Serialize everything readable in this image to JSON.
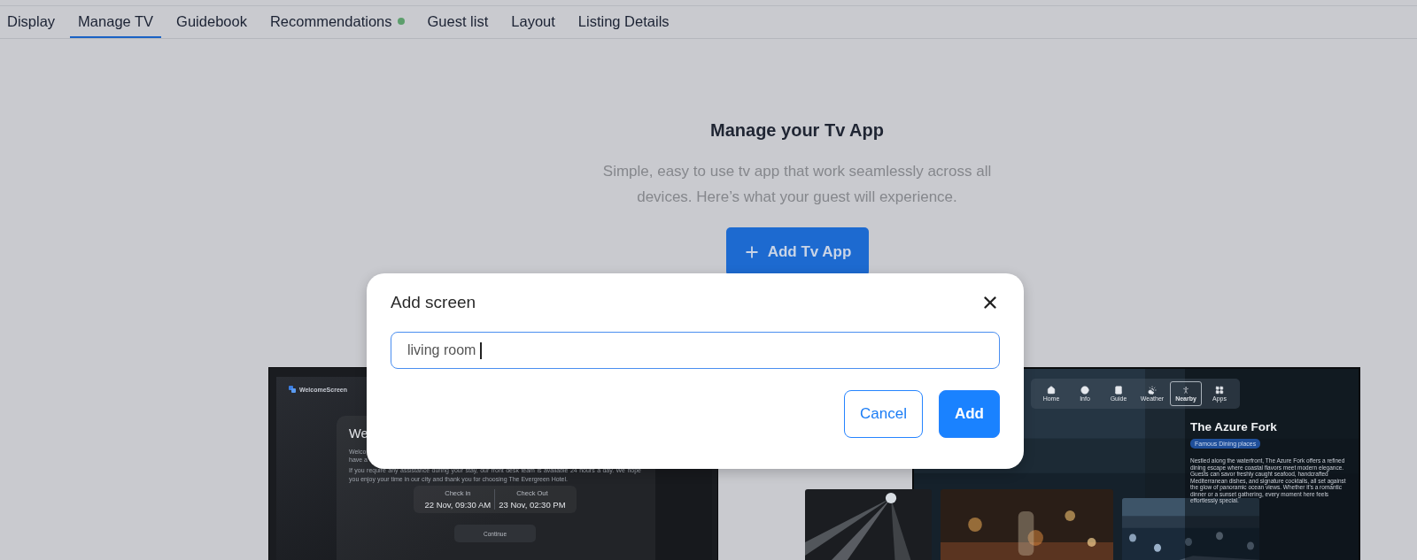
{
  "tabs": [
    {
      "label": "Display",
      "selected": false,
      "dot": false
    },
    {
      "label": "Manage TV",
      "selected": true,
      "dot": false
    },
    {
      "label": "Guidebook",
      "selected": false,
      "dot": false
    },
    {
      "label": "Recommendations",
      "selected": false,
      "dot": true
    },
    {
      "label": "Guest list",
      "selected": false,
      "dot": false
    },
    {
      "label": "Layout",
      "selected": false,
      "dot": false
    },
    {
      "label": "Listing Details",
      "selected": false,
      "dot": false
    }
  ],
  "header": {
    "title": "Manage your Tv App",
    "subtitle": "Simple, easy to use tv app that work seamlessly across all devices. Here’s what your guest will experience.",
    "button": "Add Tv App"
  },
  "welcome_preview": {
    "logo": "WelcomeScreen",
    "heading": "We",
    "lines": [
      "Welco",
      "have a"
    ],
    "paragraph": "If you require any assistance during your stay, our front desk team is available 24 hours a day. We hope you enjoy your time in our city and thank you for choosing The Evergreen Hotel.",
    "times": [
      {
        "label": "Check in",
        "value": "22 Nov, 09:30 AM"
      },
      {
        "label": "Check Out",
        "value": "23 Nov, 02:30 PM"
      }
    ],
    "button": "Continue"
  },
  "nearby_preview": {
    "nav": [
      {
        "label": "Home",
        "selected": false
      },
      {
        "label": "Info",
        "selected": false
      },
      {
        "label": "Guide",
        "selected": false
      },
      {
        "label": "Weather",
        "selected": false
      },
      {
        "label": "Nearby",
        "selected": true
      },
      {
        "label": "Apps",
        "selected": false
      }
    ],
    "title": "The Azure Fork",
    "tag": "Famous Dining places",
    "description": "Nestled along the waterfront, The Azure Fork offers a refined dining escape where coastal flavors meet modern elegance. Guests can savor freshly caught seafood, handcrafted Mediterranean dishes, and signature cocktails, all set against the glow of panoramic ocean views. Whether it's a romantic dinner or a sunset gathering, every moment here feels effortlessly special."
  },
  "dialog": {
    "title": "Add screen",
    "input_value": "living room",
    "buttons": [
      {
        "label": "Cancel",
        "kind": "secondary"
      },
      {
        "label": "Add",
        "kind": "primary"
      }
    ]
  }
}
